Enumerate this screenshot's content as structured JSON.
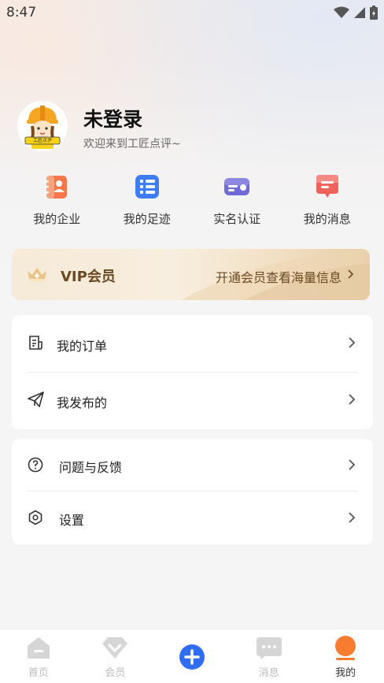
{
  "status": {
    "time": "8:47"
  },
  "profile": {
    "name": "未登录",
    "welcome": "欢迎来到工匠点评~",
    "avatar_sign": "工匠点评"
  },
  "quick": [
    {
      "label": "我的企业",
      "icon": "enterprise-icon",
      "color": "#f7774a"
    },
    {
      "label": "我的足迹",
      "icon": "footprint-icon",
      "color": "#3e7cf3"
    },
    {
      "label": "实名认证",
      "icon": "id-card-icon",
      "color": "#6f6ad6"
    },
    {
      "label": "我的消息",
      "icon": "message-icon",
      "color": "#f0625c"
    }
  ],
  "vip": {
    "title": "VIP会员",
    "desc": "开通会员查看海量信息"
  },
  "menu1": [
    {
      "label": "我的订单",
      "icon": "order-icon"
    },
    {
      "label": "我发布的",
      "icon": "send-icon"
    }
  ],
  "menu2": [
    {
      "label": "问题与反馈",
      "icon": "question-icon"
    },
    {
      "label": "设置",
      "icon": "settings-icon"
    }
  ],
  "tabs": [
    {
      "label": "首页",
      "icon": "home-icon",
      "active": false
    },
    {
      "label": "会员",
      "icon": "diamond-icon",
      "active": false
    },
    {
      "label": "",
      "icon": "plus-icon",
      "active": false
    },
    {
      "label": "消息",
      "icon": "chat-icon",
      "active": false
    },
    {
      "label": "我的",
      "icon": "profile-icon",
      "active": true
    }
  ],
  "colors": {
    "accent": "#f97b2f",
    "plus": "#2f6ef2",
    "vip_text": "#6b4a22"
  }
}
